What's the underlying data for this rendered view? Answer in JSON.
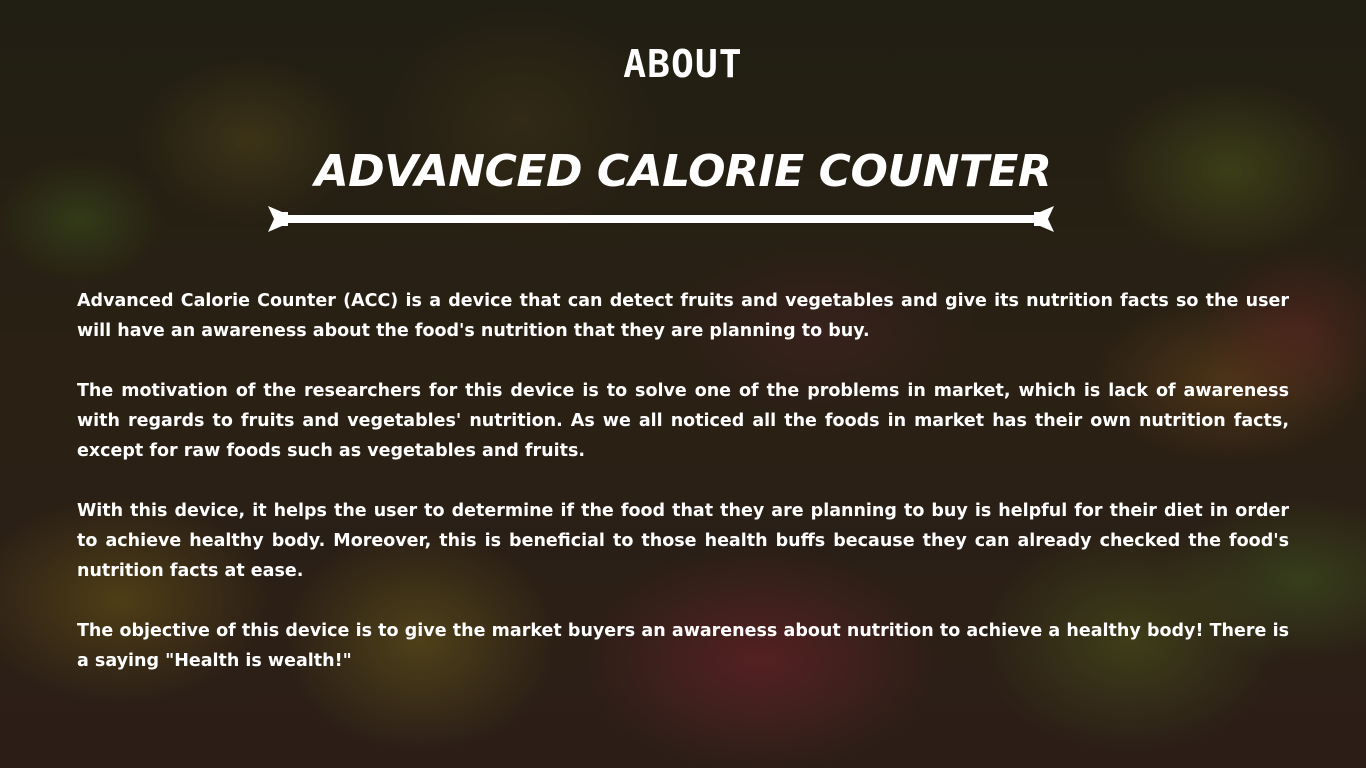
{
  "header": {
    "section_label": "ABOUT",
    "title": "ADVANCED CALORIE COUNTER"
  },
  "about": {
    "paragraphs": [
      "Advanced Calorie Counter (ACC) is a device that can detect fruits and vegetables and give its nutrition facts so the user will have an awareness about the food's nutrition that they are planning to buy.",
      "The motivation of the researchers for this device is to solve one of the problems in market, which is lack of awareness with regards to fruits and vegetables' nutrition. As we all noticed all the foods in market has their own nutrition facts, except for raw foods such as vegetables and fruits.",
      "With this device, it helps the user to determine if the food that they are planning to buy is helpful for their diet in order to achieve healthy body. Moreover, this is beneficial to those health buffs because they can already checked the food's nutrition facts at ease.",
      "The objective of this device is to give the market buyers an awareness about nutrition to achieve a healthy body! There is a saying \"Health is wealth!\""
    ]
  },
  "style": {
    "text_color": "#ffffff",
    "background_image": "market-produce-photo"
  }
}
